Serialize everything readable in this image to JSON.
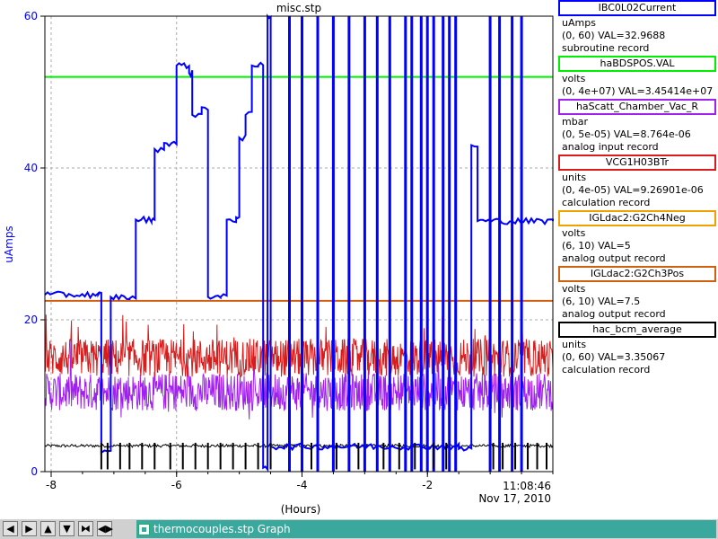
{
  "chart_data": {
    "type": "line",
    "title": "misc.stp",
    "xlabel": "(Hours)",
    "ylabel": "uAmps",
    "xlim": [
      -8.1,
      0
    ],
    "ylim": [
      0,
      60
    ],
    "x_ticks": [
      -8,
      -6,
      -4,
      -2
    ],
    "y_ticks": [
      0,
      20,
      40,
      60
    ],
    "grid": true,
    "time_label": "11:08:46",
    "date_label": "Nov 17, 2010",
    "series": [
      {
        "name": "IBC0L02Current",
        "color": "#0000ff",
        "axis_range": "(0, 60)",
        "val": "VAL=32.9688",
        "unit": "uAmps",
        "record": "subroutine record",
        "steps": [
          [
            -8.1,
            23.3
          ],
          [
            -7.25,
            23.3
          ],
          [
            -7.2,
            2.5
          ],
          [
            -7.05,
            23.0
          ],
          [
            -6.75,
            22.8
          ],
          [
            -6.65,
            33.2
          ],
          [
            -6.4,
            33.0
          ],
          [
            -6.35,
            42.5
          ],
          [
            -6.2,
            43.3
          ],
          [
            -6.0,
            53.5
          ],
          [
            -5.8,
            52.5
          ],
          [
            -5.75,
            47.0
          ],
          [
            -5.6,
            48.0
          ],
          [
            -5.5,
            23.0
          ],
          [
            -5.3,
            23.0
          ],
          [
            -5.2,
            33.2
          ],
          [
            -5.05,
            33.5
          ],
          [
            -5.0,
            44.0
          ],
          [
            -4.9,
            47.0
          ],
          [
            -4.8,
            53.5
          ],
          [
            -4.7,
            53.5
          ],
          [
            -4.62,
            0.5
          ],
          [
            -4.55,
            60
          ],
          [
            -4.5,
            3.3
          ],
          [
            -2.6,
            3.3
          ],
          [
            -1.5,
            3.0
          ],
          [
            -1.3,
            43.0
          ],
          [
            -1.2,
            33.0
          ],
          [
            0,
            33.0
          ]
        ],
        "spikes_x": [
          -4.2,
          -4.0,
          -3.75,
          -3.5,
          -3.25,
          -3.0,
          -2.8,
          -2.6,
          -2.35,
          -2.25,
          -2.1,
          -2.0,
          -1.9,
          -1.75,
          -1.65,
          -1.55,
          -1.0,
          -0.85,
          -0.65,
          -0.5
        ],
        "low_x": [
          -7.2,
          -7.1,
          -6.9,
          -6.75,
          -6.55,
          -6.35,
          -6.1,
          -5.9,
          -5.7,
          -5.5,
          -5.3,
          -5.1,
          -4.9,
          -4.7,
          -4.5,
          -3.85,
          -3.45,
          -3.1,
          -2.7,
          -2.45,
          -2.2,
          -1.9,
          -1.7,
          -0.95,
          -0.8,
          -0.6,
          -0.4,
          -0.25,
          -0.1
        ]
      },
      {
        "name": "haBDSPOS.VAL",
        "color": "#00ee00",
        "axis_range": "(0, 4e+07)",
        "val": "VAL=3.45414e+07",
        "unit": "volts",
        "record": "",
        "value": 52
      },
      {
        "name": "haScatt_Chamber_Vac_R",
        "color": "#a020f0",
        "axis_range": "(0, 5e-05)",
        "val": "VAL=8.764e-06",
        "unit": "mbar",
        "record": "analog input record",
        "mean": 10.5,
        "noise": 2.5
      },
      {
        "name": "VCG1H03BTr",
        "color": "#d81c1c",
        "axis_range": "(0, 4e-05)",
        "val": "VAL=9.26901e-06",
        "unit": "units",
        "record": "calculation record",
        "mean": 15.0,
        "noise": 2.5
      },
      {
        "name": "IGLdac2:G2Ch4Neg",
        "color": "#f0a000",
        "axis_range": "(6, 10)",
        "val": "VAL=5",
        "unit": "volts",
        "record": "analog output record"
      },
      {
        "name": "IGLdac2:G2Ch3Pos",
        "color": "#d06010",
        "axis_range": "(6, 10)",
        "val": "VAL=7.5",
        "unit": "volts",
        "record": "analog output record",
        "value": 22.5
      },
      {
        "name": "hac_bcm_average",
        "color": "#000000",
        "axis_range": "(0, 60)",
        "val": "VAL=3.35067",
        "unit": "units",
        "record": "calculation record",
        "value": 3.4
      }
    ]
  },
  "taskbar": {
    "buttons": [
      {
        "name": "scroll-left",
        "glyph": "◀"
      },
      {
        "name": "scroll-right",
        "glyph": "▶"
      },
      {
        "name": "scroll-up",
        "glyph": "▲"
      },
      {
        "name": "scroll-down",
        "glyph": "▼"
      },
      {
        "name": "zoom-in",
        "glyph": "⧓"
      },
      {
        "name": "zoom-out",
        "glyph": "◀▶"
      }
    ],
    "task_label": "thermocouples.stp Graph"
  }
}
